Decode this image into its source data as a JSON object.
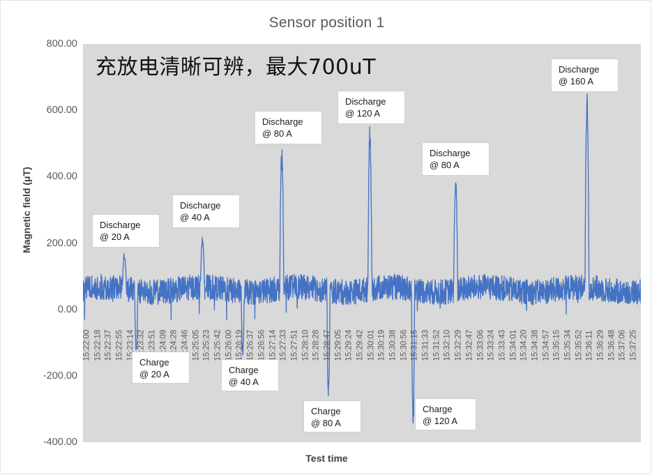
{
  "chart_data": {
    "type": "line",
    "title": "Sensor position 1",
    "xlabel": "Test time",
    "ylabel": "Magnetic field (μT)",
    "ylim": [
      -400,
      800
    ],
    "yticks": [
      "800.00",
      "600.00",
      "400.00",
      "200.00",
      "0.00",
      "-200.00",
      "-400.00"
    ],
    "ytick_values": [
      800,
      600,
      400,
      200,
      0,
      -200,
      -400
    ],
    "grid": false,
    "legend": "none",
    "series_name": "Magnetic field",
    "series_color": "#4472c4",
    "plot_background": "#d9d9d9",
    "xticks": [
      "15:22:00",
      "15:22:18",
      "15:22:37",
      "15:22:55",
      "15:23:14",
      "15:23:32",
      "15:23:51",
      "15:24:09",
      "15:24:28",
      "15:24:46",
      "15:25:05",
      "15:25:23",
      "15:25:42",
      "15:26:00",
      "15:26:19",
      "15:26:37",
      "15:26:56",
      "15:27:14",
      "15:27:33",
      "15:27:51",
      "15:28:10",
      "15:28:28",
      "15:28:47",
      "15:29:05",
      "15:29:24",
      "15:29:42",
      "15:30:01",
      "15:30:19",
      "15:30:38",
      "15:30:56",
      "15:31:15",
      "15:31:33",
      "15:31:52",
      "15:32:10",
      "15:32:29",
      "15:32:47",
      "15:33:06",
      "15:33:24",
      "15:33:43",
      "15:34:01",
      "15:34:20",
      "15:34:38",
      "15:34:57",
      "15:35:15",
      "15:35:34",
      "15:35:52",
      "15:36:11",
      "15:36:29",
      "15:36:48",
      "15:37:06",
      "15:37:25"
    ],
    "baseline_mean": 60,
    "baseline_noise_amplitude": 45,
    "events": [
      {
        "label": "Discharge @ 20 A",
        "time": "15:23:10",
        "peak": 165,
        "kind": "discharge",
        "current_A": 20
      },
      {
        "label": "Charge @ 20 A",
        "time": "15:23:30",
        "peak": -125,
        "kind": "charge",
        "current_A": 20
      },
      {
        "label": "Discharge @ 40 A",
        "time": "15:25:22",
        "peak": 215,
        "kind": "discharge",
        "current_A": 40
      },
      {
        "label": "Charge @ 40 A",
        "time": "15:26:30",
        "peak": -130,
        "kind": "charge",
        "current_A": 40
      },
      {
        "label": "Discharge @ 80 A",
        "time": "15:27:36",
        "peak": 475,
        "kind": "discharge",
        "current_A": 80
      },
      {
        "label": "Charge @ 80 A",
        "time": "15:28:55",
        "peak": -262,
        "kind": "charge",
        "current_A": 80
      },
      {
        "label": "Discharge @ 120 A",
        "time": "15:30:05",
        "peak": 535,
        "kind": "discharge",
        "current_A": 120
      },
      {
        "label": "Charge @ 120 A",
        "time": "15:31:18",
        "peak": -345,
        "kind": "charge",
        "current_A": 120
      },
      {
        "label": "Discharge @ 80 A",
        "time": "15:32:30",
        "peak": 380,
        "kind": "discharge",
        "current_A": 80
      },
      {
        "label": "Discharge @ 160 A",
        "time": "15:36:12",
        "peak": 635,
        "kind": "discharge",
        "current_A": 160
      }
    ]
  },
  "annotations": {
    "note_cn": "充放电清晰可辨，最大700uT",
    "callouts": [
      {
        "line1": "Discharge",
        "line2": "@ 20 A"
      },
      {
        "line1": "Discharge",
        "line2": "@ 40 A"
      },
      {
        "line1": "Discharge",
        "line2": "@ 80 A"
      },
      {
        "line1": "Discharge",
        "line2": "@ 120 A"
      },
      {
        "line1": "Discharge",
        "line2": "@ 80 A"
      },
      {
        "line1": "Discharge",
        "line2": "@ 160 A"
      },
      {
        "line1": "Charge",
        "line2": "@ 20 A"
      },
      {
        "line1": "Charge",
        "line2": "@ 40 A"
      },
      {
        "line1": "Charge",
        "line2": "@ 80 A"
      },
      {
        "line1": "Charge",
        "line2": "@ 120 A"
      }
    ]
  }
}
